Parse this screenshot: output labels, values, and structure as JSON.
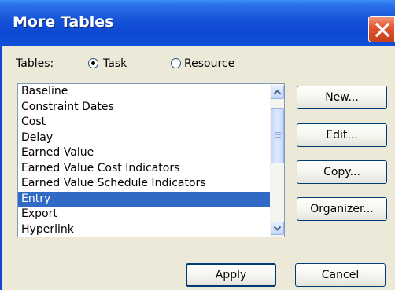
{
  "window": {
    "title": "More Tables"
  },
  "tables": {
    "label": "Tables:",
    "options": [
      {
        "label": "Task",
        "checked": true
      },
      {
        "label": "Resource",
        "checked": false
      }
    ]
  },
  "list": {
    "items": [
      "Baseline",
      "Constraint Dates",
      "Cost",
      "Delay",
      "Earned Value",
      "Earned Value Cost Indicators",
      "Earned Value Schedule Indicators",
      "Entry",
      "Export",
      "Hyperlink"
    ],
    "selected": "Entry"
  },
  "buttons": {
    "new": "New...",
    "edit": "Edit...",
    "copy": "Copy...",
    "organizer": "Organizer...",
    "apply": "Apply",
    "cancel": "Cancel"
  },
  "colors": {
    "titlebar": "#0c48d0",
    "selection": "#316ac5",
    "dialog": "#ece9d8",
    "close": "#e0552e"
  }
}
